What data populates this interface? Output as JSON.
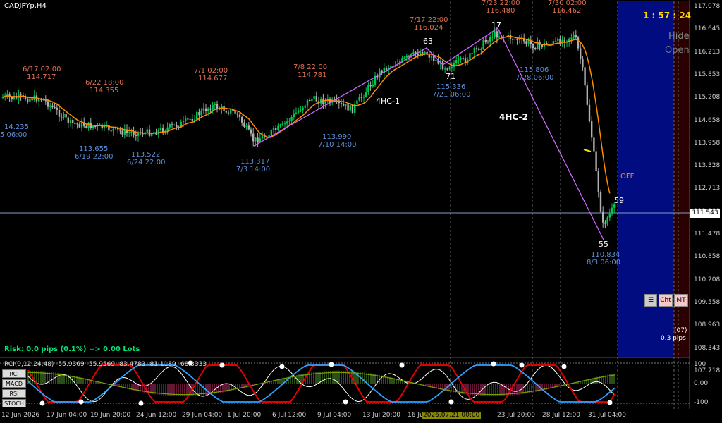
{
  "header": {
    "symbol": "CADJPYp,H4",
    "timer": "1 : 57 : 24",
    "hide_label": "Hide",
    "open_label": "Open"
  },
  "labels": {
    "off": "OFF",
    "risk": "Risk: 0.0 pips (0.1%) => 0.00 Lots",
    "spread_count": "(07)",
    "spread_pips": "0.3 pips",
    "current_price": "111.543",
    "wave1": "4HC-1",
    "wave2": "4HC-2",
    "highlight_date": "2026.07.21 00:00"
  },
  "toolbar": {
    "cht": "Cht",
    "mt": "MT"
  },
  "subwindow": {
    "title": "RCI(9,12,24,48) -55.9369 -55.9569 -83.4783 -81.1189 -68.3333",
    "tabs": [
      "RCI",
      "MACD",
      "RSI",
      "STOCH"
    ],
    "levels": [
      "100",
      "0.00",
      "-100"
    ]
  },
  "y_axis": [
    "117.078",
    "116.645",
    "116.213",
    "115.853",
    "115.208",
    "114.658",
    "113.958",
    "113.328",
    "112.713",
    "112.098",
    "111.478",
    "110.858",
    "110.208",
    "109.558",
    "108.963",
    "108.343",
    "107.718"
  ],
  "x_axis": [
    "12 Jun 2026",
    "17 Jun 04:00",
    "19 Jun 20:00",
    "24 Jun 12:00",
    "29 Jun 04:00",
    "1 Jul 20:00",
    "6 Jul 12:00",
    "9 Jul 04:00",
    "13 Jul 20:00",
    "16 Jul 12:00",
    "23 Jul 20:00",
    "28 Jul 12:00",
    "31 Jul 04:00"
  ],
  "annotations": [
    {
      "date": "6/17 02:00",
      "price": "114.717",
      "kind": "high"
    },
    {
      "date": "6/22 18:00",
      "price": "114.355",
      "kind": "high"
    },
    {
      "date": "7/1 02:00",
      "price": "114.677",
      "kind": "high"
    },
    {
      "date": "7/8 22:00",
      "price": "114.781",
      "kind": "high"
    },
    {
      "date": "7/17 22:00",
      "price": "116.024",
      "kind": "high"
    },
    {
      "date": "7/23 22:00",
      "price": "116.480",
      "kind": "high"
    },
    {
      "date": "7/30 02:00",
      "price": "116.462",
      "kind": "high"
    },
    {
      "date": "6/19 22:00",
      "price": "113.655",
      "kind": "low"
    },
    {
      "date": "6/24 22:00",
      "price": "113.522",
      "kind": "low"
    },
    {
      "date": "7/3 14:00",
      "price": "113.317",
      "kind": "low"
    },
    {
      "date": "7/10 14:00",
      "price": "113.990",
      "kind": "low"
    },
    {
      "date": "7/21 06:00",
      "price": "115.336",
      "kind": "low"
    },
    {
      "date": "7/28 06:00",
      "price": "115.806",
      "kind": "low"
    },
    {
      "date": "8/3 06:00",
      "price": "110.834",
      "kind": "low"
    },
    {
      "date": "5 06:00",
      "price": "14.235",
      "kind": "low"
    }
  ],
  "wave_numbers": [
    "63",
    "71",
    "17",
    "55",
    "59"
  ],
  "colors": {
    "bull": "#00c853",
    "bear": "#b0b0b0",
    "ma": "#ff8c00",
    "trend": "#cc66ff",
    "high_text": "#e07050",
    "low_text": "#5b8fd9",
    "session_bg": "#000c80"
  }
}
